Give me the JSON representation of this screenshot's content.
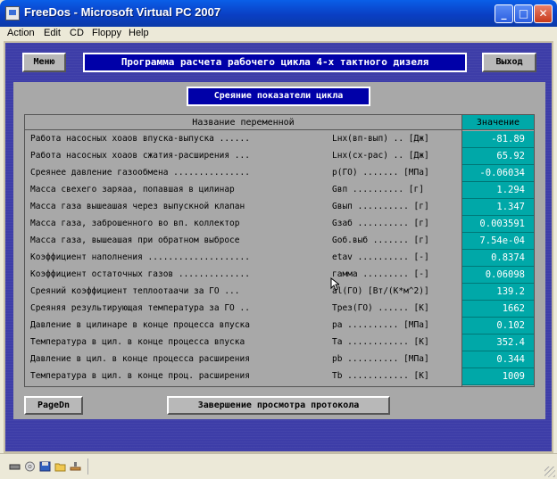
{
  "window": {
    "title": "FreeDos - Microsoft Virtual PC 2007"
  },
  "menubar": {
    "items": [
      "Action",
      "Edit",
      "CD",
      "Floppy",
      "Help"
    ]
  },
  "dos": {
    "menu_button": "Меню",
    "program_title": "Программа расчета рабочего цикла 4-х тактного дизеля",
    "exit_button": "Выход",
    "section_title": "Среяние показатели цикла",
    "col_name": "Название переменной",
    "col_value": "Значение",
    "rows": [
      {
        "name": "Работа насосных хоаов впуска-выпуска ......",
        "sym": "Lнх(вп-вып) .. [Дж]",
        "value": "-81.89"
      },
      {
        "name": "Работа насосных хоаов сжатия-расширения ...",
        "sym": "Lнх(сх-рас) .. [Дж]",
        "value": "65.92"
      },
      {
        "name": "Среянее давление газообмена ...............",
        "sym": "p(ГО) ....... [МПа]",
        "value": "-0.06034"
      },
      {
        "name": "Масса свехего заряаа, попавшая в цилинар",
        "sym": "Gвп .......... [г]",
        "value": "1.294"
      },
      {
        "name": "Масса газа вышеашая через выпускной клапан",
        "sym": "Gвып .......... [г]",
        "value": "1.347"
      },
      {
        "name": "Масса газа, заброшенного во вп. коллектор",
        "sym": "Gзаб .......... [г]",
        "value": "0.003591"
      },
      {
        "name": "Масса газа, вышеашая при обратном выбросе",
        "sym": "Gоб.выб ....... [г]",
        "value": "7.54e-04"
      },
      {
        "name": "Коэффициент наполнения ....................",
        "sym": "etav .......... [-]",
        "value": "0.8374"
      },
      {
        "name": "Коэффициент остаточных газов ..............",
        "sym": "гамма ......... [-]",
        "value": "0.06098"
      },
      {
        "name": "Среяний коэффициент теплоотаачи за ГО ...",
        "sym": "al(ГО) [Вт/(К*м^2)]",
        "value": "139.2"
      },
      {
        "name": "Среяняя результирующая температура за ГО ..",
        "sym": "Tрез(ГО) ...... [К]",
        "value": "1662"
      },
      {
        "name": "Давление в цилинаре в конце процесса впуска",
        "sym": "pa .......... [МПа]",
        "value": "0.102"
      },
      {
        "name": "Температура в цил. в конце процесса впуска",
        "sym": "Ta ............ [К]",
        "value": "352.4"
      },
      {
        "name": "Давление в цил. в конце процесса расширения",
        "sym": "pb .......... [МПа]",
        "value": "0.344"
      },
      {
        "name": "Температура в цил. в конце проц. расширения",
        "sym": "Tb ............ [К]",
        "value": "1009"
      }
    ],
    "pagedn_button": "PageDn",
    "finish_button": "Завершение просмотра протокола"
  }
}
